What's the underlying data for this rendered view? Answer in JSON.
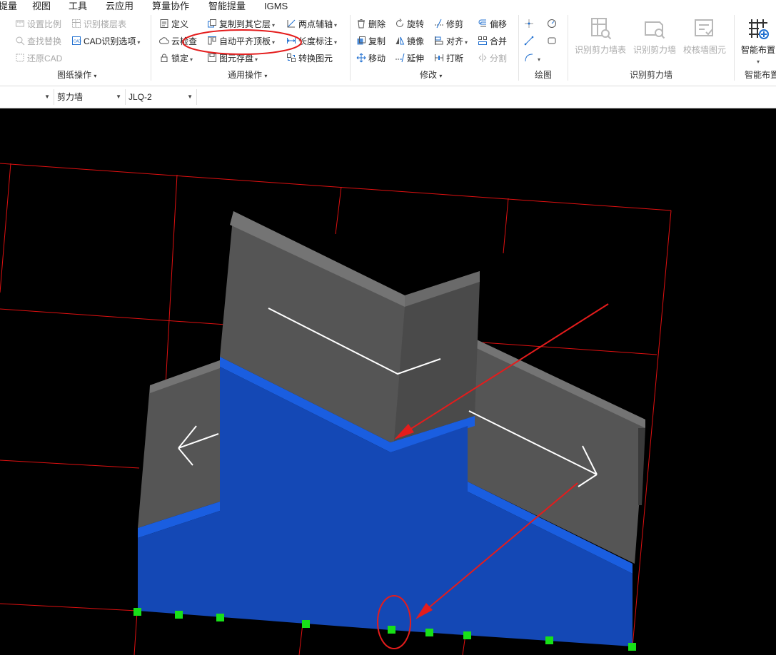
{
  "menu": [
    "提量",
    "视图",
    "工具",
    "云应用",
    "算量协作",
    "智能提量",
    "IGMS"
  ],
  "ribbon": {
    "drawing_ops": {
      "title": "图纸操作",
      "items": [
        "设置比例",
        "识别楼层表",
        "查找替换",
        "CAD识别选项",
        "还原CAD"
      ]
    },
    "common_ops": {
      "title": "通用操作",
      "items": [
        "定义",
        "复制到其它层",
        "两点辅轴",
        "云检查",
        "自动平齐顶板",
        "长度标注",
        "锁定",
        "图元存盘",
        "转换图元"
      ]
    },
    "modify": {
      "title": "修改",
      "items": [
        "删除",
        "旋转",
        "修剪",
        "偏移",
        "复制",
        "镜像",
        "对齐",
        "合并",
        "移动",
        "延伸",
        "打断",
        "分割"
      ]
    },
    "draw": {
      "title": "绘图"
    },
    "recognize_wall": {
      "title": "识别剪力墙",
      "buttons": [
        "识别剪力墙表",
        "识别剪力墙",
        "校核墙图元"
      ]
    },
    "smart_layout": {
      "title": "智能布置",
      "button": "智能布置"
    }
  },
  "propbar": {
    "type_value": "剪力墙",
    "name_value": "JLQ-2"
  },
  "colors": {
    "wall_gray": "#555555",
    "wall_top": "#747474",
    "wall_blue": "#1448b5",
    "wall_blue_band": "#1a5ee0",
    "grid_red": "#e01010",
    "grip_green": "#18e018",
    "annotation_red": "#e41c1c"
  }
}
